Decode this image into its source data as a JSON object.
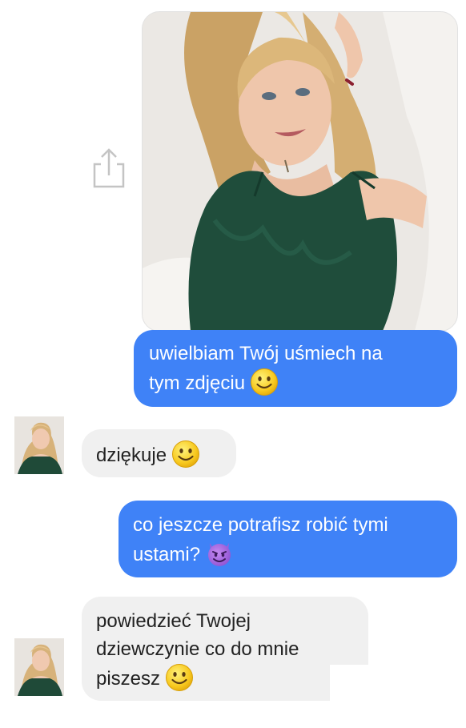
{
  "messages": [
    {
      "side": "sent",
      "lines": [
        "uwielbiam Twój uśmiech na",
        "tym zdjęciu"
      ],
      "emoji": "smiley-emoji"
    },
    {
      "side": "received",
      "lines": [
        "dziękuje"
      ],
      "emoji": "smiley-emoji"
    },
    {
      "side": "sent",
      "lines": [
        "co jeszcze potrafisz robić tymi",
        "ustami?"
      ],
      "emoji": "smiling-devil-emoji"
    },
    {
      "side": "received",
      "lines": [
        "powiedzieć Twojej",
        "dziewczynie co do mnie",
        "piszesz"
      ],
      "emoji": "smiley-emoji"
    }
  ],
  "colors": {
    "sent_bubble": "#3f82f7",
    "received_bubble": "#f0f0f0",
    "sent_text": "#ffffff",
    "received_text": "#222222"
  },
  "icons": [
    "share-icon",
    "smiley-emoji",
    "smiling-devil-emoji",
    "avatar"
  ]
}
